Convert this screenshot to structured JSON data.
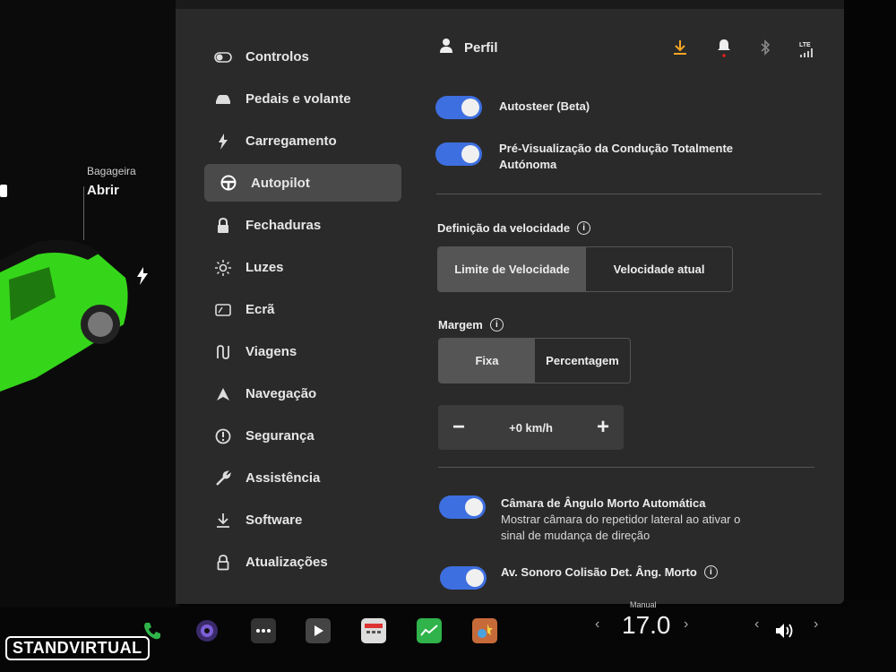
{
  "car": {
    "trunk_label": "Bagageira",
    "trunk_action": "Abrir"
  },
  "sidebar": {
    "items": [
      {
        "label": "Controlos",
        "icon": "toggle-icon"
      },
      {
        "label": "Pedais e volante",
        "icon": "car-icon"
      },
      {
        "label": "Carregamento",
        "icon": "bolt-icon"
      },
      {
        "label": "Autopilot",
        "icon": "steering-wheel-icon",
        "active": true
      },
      {
        "label": "Fechaduras",
        "icon": "lock-icon"
      },
      {
        "label": "Luzes",
        "icon": "sun-icon"
      },
      {
        "label": "Ecrã",
        "icon": "screen-icon"
      },
      {
        "label": "Viagens",
        "icon": "trips-icon"
      },
      {
        "label": "Navegação",
        "icon": "navigation-arrow-icon"
      },
      {
        "label": "Segurança",
        "icon": "alert-circle-icon"
      },
      {
        "label": "Assistência",
        "icon": "wrench-icon"
      },
      {
        "label": "Software",
        "icon": "download-icon"
      },
      {
        "label": "Atualizações",
        "icon": "lock-outline-icon"
      }
    ]
  },
  "header": {
    "profile_label": "Perfil",
    "network": "LTE"
  },
  "settings": {
    "autosteer": "Autosteer (Beta)",
    "fsd_preview": "Pré-Visualização da Condução Totalmente Autónoma",
    "speed_title": "Definição da velocidade",
    "speed_options": [
      "Limite de Velocidade",
      "Velocidade atual"
    ],
    "margin_title": "Margem",
    "margin_options": [
      "Fixa",
      "Percentagem"
    ],
    "offset_value": "+0 km/h",
    "minus": "−",
    "plus": "+",
    "blindspot_title": "Câmara de Ângulo Morto Automática",
    "blindspot_desc_1": "Mostrar câmara do repetidor lateral ao ativar o",
    "blindspot_desc_2": "sinal de mudança de direção",
    "collision_chime": "Av. Sonoro Colisão Det. Âng. Morto"
  },
  "dock": {
    "temp_mode": "Manual",
    "temperature": "17.0",
    "watermark": "STANDVIRTUAL"
  },
  "colors": {
    "accent": "#3e6fe0",
    "download": "#f5a623",
    "notify_dot": "#e02020",
    "green_app": "#2fb34a"
  }
}
